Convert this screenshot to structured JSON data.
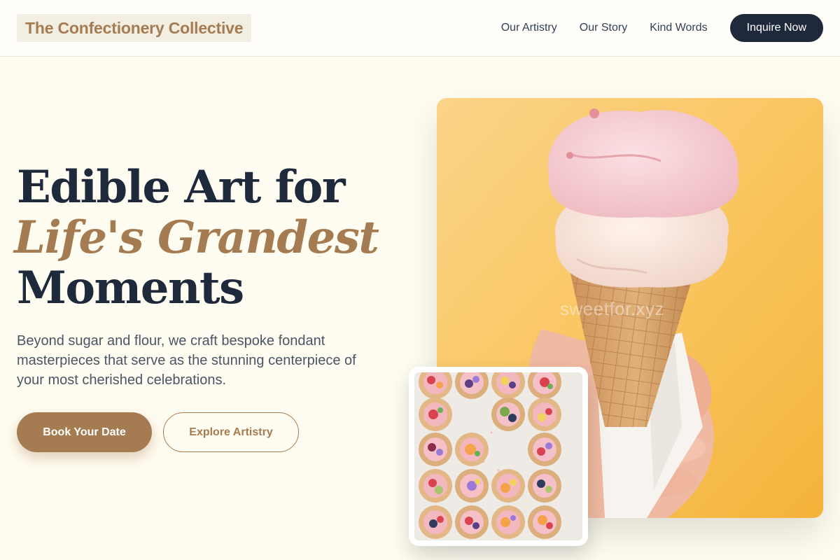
{
  "nav": {
    "brand": "The Confectionery Collective",
    "links": [
      "Our Artistry",
      "Our Story",
      "Kind Words"
    ],
    "cta": "Inquire Now"
  },
  "hero": {
    "headline_line1": "Edible Art for",
    "headline_accent": "Life's Grandest",
    "headline_line3": "Moments",
    "lead": "Beyond sugar and flour, we craft bespoke fondant masterpieces that serve as the stunning centerpiece of your most cherished celebrations.",
    "primary_button": "Book Your Date",
    "secondary_button": "Explore Artistry"
  },
  "images": {
    "hero_watermark": "sweetfor.xyz",
    "hero_icon": "ice-cream-cone-photo",
    "inset_icon": "fruit-tartlets-photo"
  },
  "colors": {
    "accent": "#a57c52",
    "navy": "#1e293b",
    "background": "#fffcf1"
  }
}
